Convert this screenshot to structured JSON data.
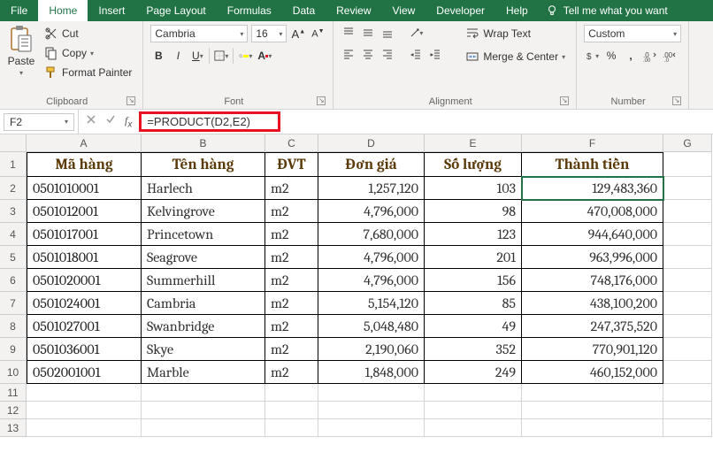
{
  "tabs": {
    "file": "File",
    "home": "Home",
    "insert": "Insert",
    "page_layout": "Page Layout",
    "formulas": "Formulas",
    "data": "Data",
    "review": "Review",
    "view": "View",
    "developer": "Developer",
    "help": "Help",
    "tellme": "Tell me what you want"
  },
  "ribbon": {
    "clipboard": {
      "paste": "Paste",
      "cut": "Cut",
      "copy": "Copy",
      "format_painter": "Format Painter",
      "label": "Clipboard"
    },
    "font": {
      "name": "Cambria",
      "size": "16",
      "label": "Font"
    },
    "alignment": {
      "wrap_text": "Wrap Text",
      "merge_center": "Merge & Center",
      "label": "Alignment"
    },
    "number": {
      "format": "Custom",
      "label": "Number"
    }
  },
  "formula_bar": {
    "cell_ref": "F2",
    "formula": "=PRODUCT(D2,E2)"
  },
  "columns": [
    "A",
    "B",
    "C",
    "D",
    "E",
    "F",
    "G"
  ],
  "header_row": {
    "A": "Mã hàng",
    "B": "Tên hàng",
    "C": "ĐVT",
    "D": "Đơn giá",
    "E": "Số lượng",
    "F": "Thành tiền"
  },
  "rows": [
    {
      "n": "2",
      "A": "0501010001",
      "B": "Harlech",
      "C": "m2",
      "D": "1,257,120",
      "E": "103",
      "F": "129,483,360"
    },
    {
      "n": "3",
      "A": "0501012001",
      "B": "Kelvingrove",
      "C": "m2",
      "D": "4,796,000",
      "E": "98",
      "F": "470,008,000"
    },
    {
      "n": "4",
      "A": "0501017001",
      "B": "Princetown",
      "C": "m2",
      "D": "7,680,000",
      "E": "123",
      "F": "944,640,000"
    },
    {
      "n": "5",
      "A": "0501018001",
      "B": "Seagrove",
      "C": "m2",
      "D": "4,796,000",
      "E": "201",
      "F": "963,996,000"
    },
    {
      "n": "6",
      "A": "0501020001",
      "B": "Summerhill",
      "C": "m2",
      "D": "4,796,000",
      "E": "156",
      "F": "748,176,000"
    },
    {
      "n": "7",
      "A": "0501024001",
      "B": "Cambria",
      "C": "m2",
      "D": "5,154,120",
      "E": "85",
      "F": "438,100,200"
    },
    {
      "n": "8",
      "A": "0501027001",
      "B": "Swanbridge",
      "C": "m2",
      "D": "5,048,480",
      "E": "49",
      "F": "247,375,520"
    },
    {
      "n": "9",
      "A": "0501036001",
      "B": "Skye",
      "C": "m2",
      "D": "2,190,060",
      "E": "352",
      "F": "770,901,120"
    },
    {
      "n": "10",
      "A": "0502001001",
      "B": "Marble",
      "C": "m2",
      "D": "1,848,000",
      "E": "249",
      "F": "460,152,000"
    }
  ],
  "empty_rows": [
    "11",
    "12",
    "13"
  ]
}
